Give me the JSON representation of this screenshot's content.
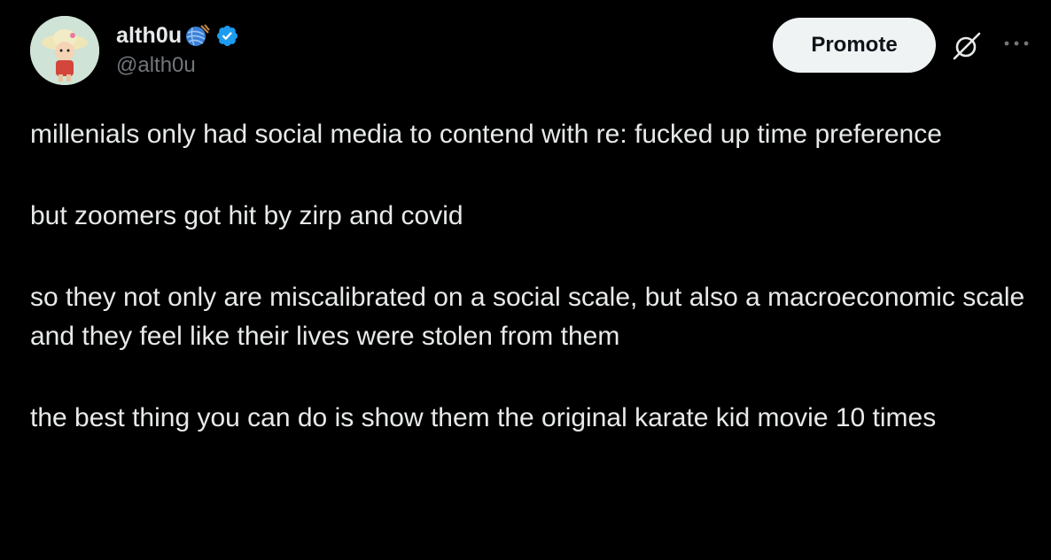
{
  "author": {
    "display_name": "alth0u",
    "handle": "@alth0u",
    "verified": true,
    "emoji_icon": "yarn-ball-icon",
    "avatar_icon": "cartoon-character-avatar"
  },
  "actions": {
    "promote_label": "Promote",
    "grok_icon": "grok-icon",
    "more_icon": "more-options-icon"
  },
  "tweet": {
    "paragraphs": [
      "millenials only had social media to contend with re: fucked up time preference",
      "but zoomers got hit by zirp and covid",
      "so they not only are miscalibrated on a social scale, but also a macroeconomic scale and they feel like their lives were stolen from them",
      "the best thing you can do is show them the original karate kid movie 10 times"
    ]
  },
  "colors": {
    "background": "#000000",
    "text_primary": "#e7e9ea",
    "text_secondary": "#71767b",
    "verified_blue": "#1d9bf0",
    "promote_bg": "#eff3f4"
  }
}
